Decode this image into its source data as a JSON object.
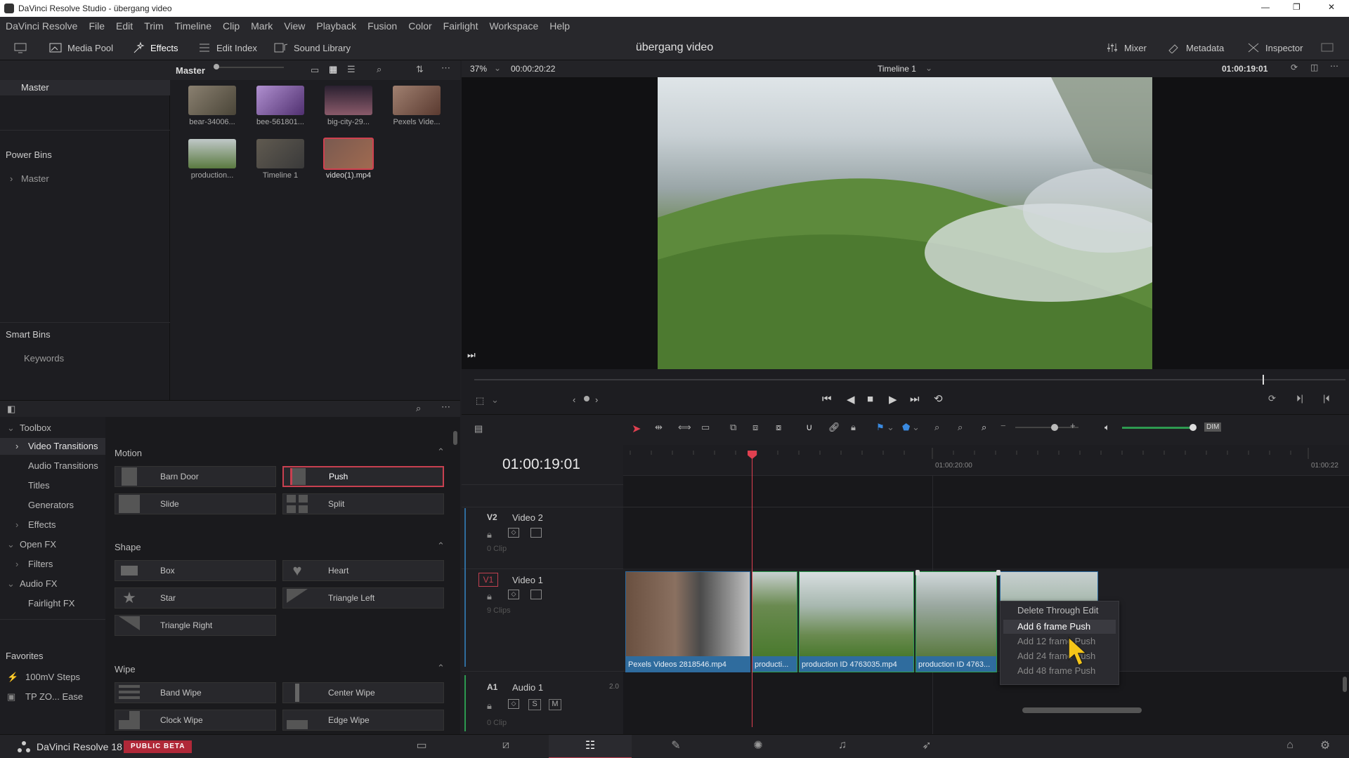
{
  "window": {
    "title": "DaVinci Resolve Studio - übergang video",
    "minimize": "—",
    "maximize": "❐",
    "close": "✕"
  },
  "menu": [
    "DaVinci Resolve",
    "File",
    "Edit",
    "Trim",
    "Timeline",
    "Clip",
    "Mark",
    "View",
    "Playback",
    "Fusion",
    "Color",
    "Fairlight",
    "Workspace",
    "Help"
  ],
  "toolbar": {
    "media_pool": "Media Pool",
    "effects": "Effects",
    "edit_index": "Edit Index",
    "sound_library": "Sound Library",
    "project": "übergang video",
    "mixer": "Mixer",
    "metadata": "Metadata",
    "inspector": "Inspector"
  },
  "media": {
    "bin_title": "Master",
    "bins": {
      "master": "Master",
      "power_bins": "Power Bins",
      "power_master": "Master",
      "smart_bins": "Smart Bins",
      "keywords": "Keywords"
    },
    "clips": [
      {
        "label": "bear-34006...",
        "color": "#6a6152"
      },
      {
        "label": "bee-561801...",
        "color": "#8a6aa8"
      },
      {
        "label": "big-city-29...",
        "color": "#5a4050"
      },
      {
        "label": "Pexels Vide...",
        "color": "#7a6050"
      },
      {
        "label": "production...",
        "color": "#6f8a58"
      },
      {
        "label": "Timeline 1",
        "color": "#5a5a50"
      },
      {
        "label": "video(1).mp4",
        "color": "#8a5040"
      }
    ]
  },
  "viewer": {
    "zoom": "37%",
    "source_tc": "00:00:20:22",
    "timeline_name": "Timeline 1",
    "record_tc": "01:00:19:01",
    "scrub_position": 0.905
  },
  "effects": {
    "tree": [
      {
        "label": "Toolbox",
        "arrow": "⌄"
      },
      {
        "label": "Video Transitions",
        "arrow": "›"
      },
      {
        "label": "Audio Transitions",
        "arrow": ""
      },
      {
        "label": "Titles",
        "arrow": ""
      },
      {
        "label": "Generators",
        "arrow": ""
      },
      {
        "label": "Effects",
        "arrow": "›"
      },
      {
        "label": "Open FX",
        "arrow": "⌄"
      },
      {
        "label": "Filters",
        "arrow": "›"
      },
      {
        "label": "Audio FX",
        "arrow": "⌄"
      },
      {
        "label": "Fairlight FX",
        "arrow": ""
      }
    ],
    "favorites_title": "Favorites",
    "favorites": [
      "100mV Steps",
      "TP ZO... Ease"
    ],
    "sections": {
      "motion": {
        "title": "Motion",
        "items": [
          "Barn Door",
          "Push",
          "Slide",
          "Split"
        ]
      },
      "shape": {
        "title": "Shape",
        "items": [
          "Box",
          "Heart",
          "Star",
          "Triangle Left",
          "Triangle Right"
        ]
      },
      "wipe": {
        "title": "Wipe",
        "items": [
          "Band Wipe",
          "Center Wipe",
          "Clock Wipe",
          "Edge Wipe"
        ]
      }
    }
  },
  "timeline": {
    "timecode": "01:00:19:01",
    "ruler_marks": [
      "01:00:20:00",
      "01:00:22"
    ],
    "tracks": {
      "v2": {
        "id": "V2",
        "name": "Video 2",
        "count": "0 Clip"
      },
      "v1": {
        "id": "V1",
        "name": "Video 1",
        "count": "9 Clips"
      },
      "a1": {
        "id": "A1",
        "name": "Audio 1",
        "channels": "2.0",
        "count": "0 Clip",
        "solo": "S",
        "mute": "M"
      }
    },
    "clips": [
      {
        "label": "Pexels Videos 2818546.mp4",
        "color": "#7a6a60"
      },
      {
        "label": "producti...",
        "color": "#4f7a3a"
      },
      {
        "label": "production ID 4763035.mp4",
        "color": "#8fa08a"
      },
      {
        "label": "production ID 4763...",
        "color": "#7a9070"
      },
      {
        "label": "",
        "color": "#a8b4b0"
      }
    ]
  },
  "context_menu": {
    "items": [
      "Delete Through Edit",
      "Add 6 frame Push",
      "Add 12 frame Push",
      "Add 24 frame Push",
      "Add 48 frame Push"
    ]
  },
  "status": {
    "app": "DaVinci Resolve 18",
    "badge": "PUBLIC BETA"
  }
}
